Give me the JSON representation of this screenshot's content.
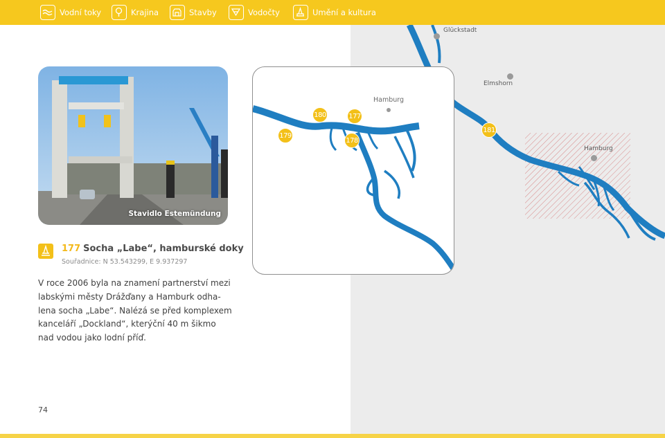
{
  "nav": {
    "items": [
      {
        "label": "Vodní toky",
        "icon": "water-icon"
      },
      {
        "label": "Krajina",
        "icon": "tree-icon"
      },
      {
        "label": "Stavby",
        "icon": "building-icon"
      },
      {
        "label": "Vodočty",
        "icon": "gauge-icon"
      },
      {
        "label": "Umění a kultura",
        "icon": "monument-icon"
      }
    ]
  },
  "photo": {
    "caption": "Stavidlo Estemündung"
  },
  "entry": {
    "number": "177",
    "title": "Socha „Labe“, hamburské doky",
    "coords": "Souřadnice: N 53.543299, E 9.937297",
    "body": [
      "V roce 2006 byla na znamení partnerství mezi",
      "labskými městy Drážďany a Hamburk odha-",
      "lena socha „Labe“. Nalézá se před komplexem",
      "kanceláří „Dockland“, kterýční 40 m šikmo",
      "nad vodou jako lodní příď."
    ]
  },
  "page_number": "74",
  "inset": {
    "city_label": "Hamburg",
    "markers": [
      "179",
      "180",
      "177",
      "178"
    ]
  },
  "map": {
    "labels": {
      "gluckstadt": "Glückstadt",
      "elmshorn": "Elmshorn",
      "hamburg": "Hamburg"
    },
    "marker": "181"
  },
  "colors": {
    "accent": "#f6c81e",
    "river": "#1f7ec1",
    "map_bg": "#ececec"
  }
}
